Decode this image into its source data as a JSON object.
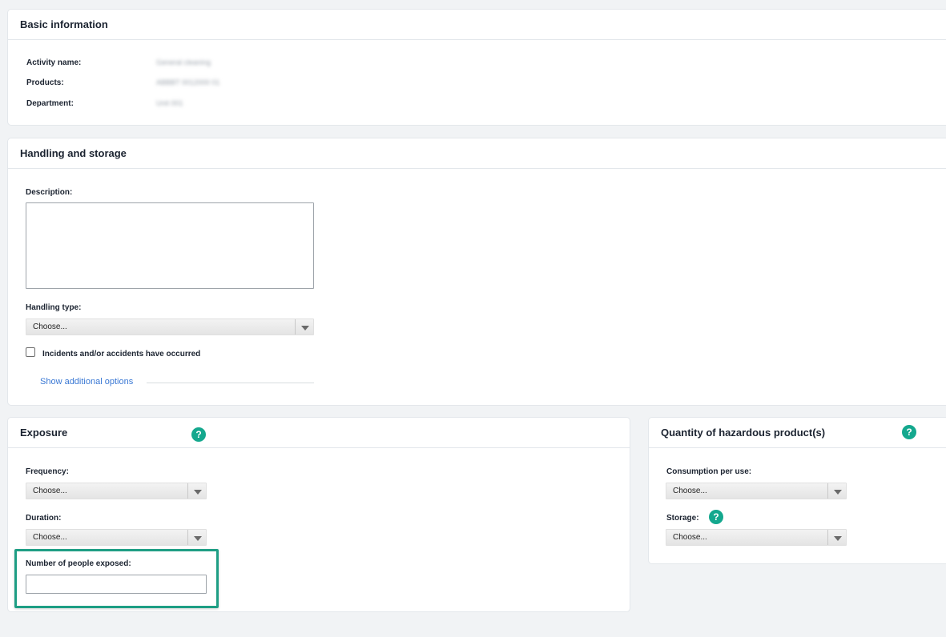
{
  "basic_info": {
    "title": "Basic information",
    "fields": [
      {
        "label": "Activity name:",
        "value": "General cleaning"
      },
      {
        "label": "Products:",
        "value": "ABBBT 0012000 01"
      },
      {
        "label": "Department:",
        "value": "Unit 001"
      }
    ]
  },
  "handling": {
    "title": "Handling and storage",
    "description_label": "Description:",
    "description_value": "",
    "handling_type_label": "Handling type:",
    "handling_type_value": "Choose...",
    "incidents_label": "Incidents and/or accidents have occurred",
    "incidents_checked": false,
    "show_more_label": "Show additional options"
  },
  "exposure": {
    "title": "Exposure",
    "help_icon": "?",
    "frequency_label": "Frequency:",
    "frequency_value": "Choose...",
    "duration_label": "Duration:",
    "duration_value": "Choose...",
    "people_label": "Number of people exposed:",
    "people_value": ""
  },
  "quantity": {
    "title": "Quantity of hazardous product(s)",
    "help_icon": "?",
    "consumption_label": "Consumption per use:",
    "consumption_value": "Choose...",
    "storage_label": "Storage:",
    "storage_help_icon": "?",
    "storage_value": "Choose..."
  },
  "colors": {
    "accent": "#14a88e",
    "highlight": "#1e9e84",
    "link": "#3a78d4",
    "background": "#f1f3f5"
  }
}
